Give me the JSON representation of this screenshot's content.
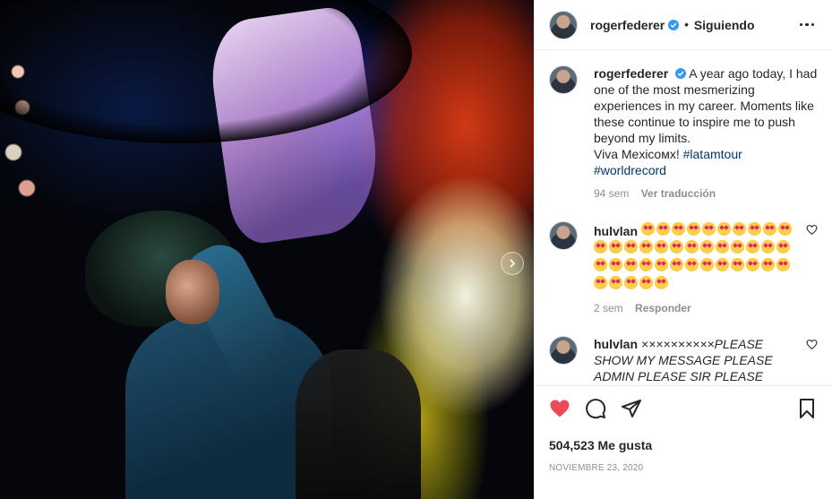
{
  "post": {
    "username": "rogerfederer",
    "follow_separator": "•",
    "follow_status": "Siguiendo"
  },
  "caption": {
    "username": "rogerfederer",
    "text": "A year ago today, I had one of the most mesmerizing experiences in my career. Moments like these continue to inspire me to push beyond my limits.",
    "line2": "Viva Mexicoмx! ",
    "hashtag1": "#latamtour",
    "hashtag2": "#worldrecord",
    "age": "94 sem",
    "translate": "Ver traducción"
  },
  "comments": [
    {
      "username": "hulvlan",
      "emoji_count": 41,
      "emoji": "smiling-face-with-heart-eyes",
      "age": "2 sem",
      "reply": "Responder"
    },
    {
      "username": "hulvlan",
      "text": "××××××××××PLEASE SHOW MY MESSAGE PLEASE ADMIN PLEASE SIR PLEASE PLEASE PLEASE"
    }
  ],
  "actions": {
    "liked": true,
    "like_color": "#ed4956"
  },
  "likes": "504,523 Me gusta",
  "date": "NOVIEMBRE 23, 2020",
  "colors": {
    "verified": "#3897f0",
    "hashtag": "#00376b",
    "muted": "#8e8e8e"
  }
}
